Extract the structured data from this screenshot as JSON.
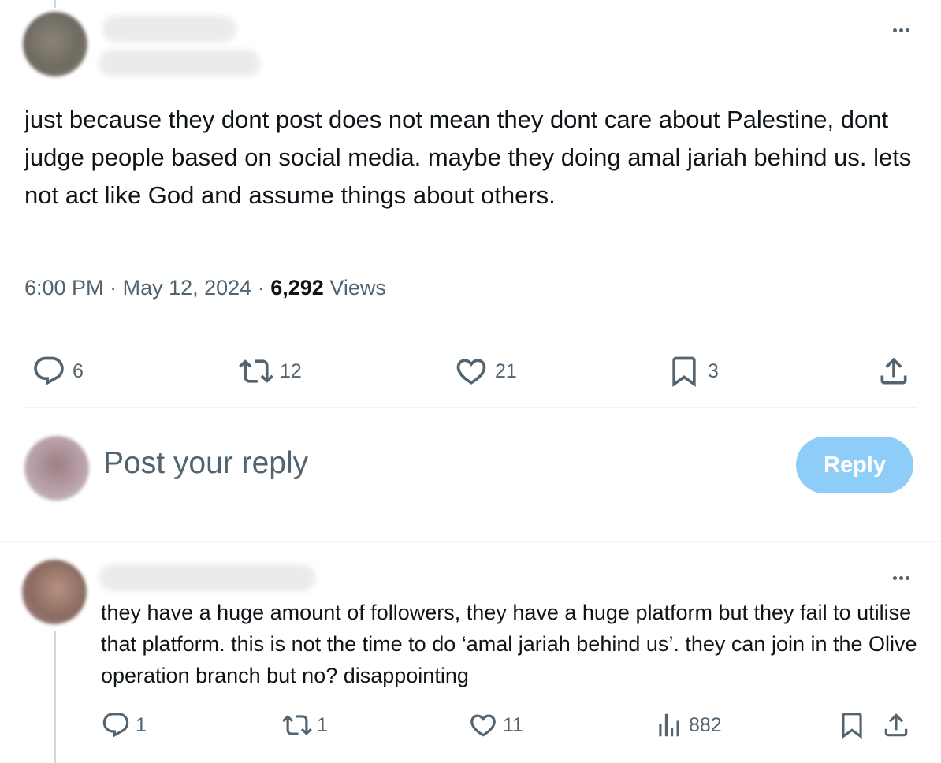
{
  "tweet": {
    "text": "just because they dont post does not mean they dont care about Palestine, dont judge people based on social media. maybe they doing amal jariah behind us. lets not act like God and assume things about others.",
    "time": "6:00 PM",
    "separator": "·",
    "date": "May 12, 2024",
    "views_count": "6,292",
    "views_label": "Views",
    "actions": {
      "replies": "6",
      "reposts": "12",
      "likes": "21",
      "bookmarks": "3"
    }
  },
  "composer": {
    "placeholder": "Post your reply",
    "button_label": "Reply"
  },
  "reply": {
    "text": "they have a huge amount of followers, they have a huge platform but they fail to utilise that platform. this is not the time to do ‘amal jariah behind us’. they can join in the Olive operation branch but no? disappointing",
    "actions": {
      "replies": "1",
      "reposts": "1",
      "likes": "11",
      "views": "882"
    }
  },
  "icons": [
    "more-icon",
    "reply-icon",
    "repost-icon",
    "like-icon",
    "bookmark-icon",
    "share-icon",
    "views-icon"
  ],
  "colors": {
    "secondary_text": "#536471",
    "reply_button": "#8ecdf8",
    "divider": "#eff3f4"
  }
}
